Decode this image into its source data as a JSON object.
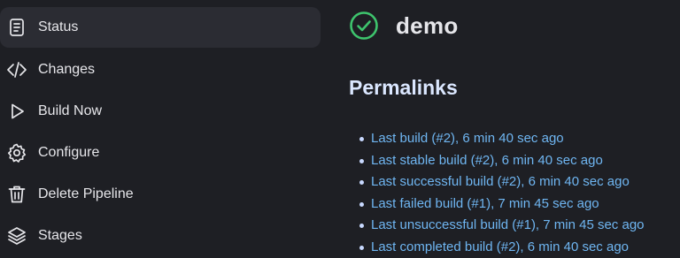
{
  "sidebar": {
    "items": [
      {
        "label": "Status",
        "icon": "document-icon",
        "active": true
      },
      {
        "label": "Changes",
        "icon": "code-icon",
        "active": false
      },
      {
        "label": "Build Now",
        "icon": "play-icon",
        "active": false
      },
      {
        "label": "Configure",
        "icon": "gear-icon",
        "active": false
      },
      {
        "label": "Delete Pipeline",
        "icon": "trash-icon",
        "active": false
      },
      {
        "label": "Stages",
        "icon": "layers-icon",
        "active": false
      }
    ]
  },
  "main": {
    "title": "demo",
    "status_icon": "success-check-icon",
    "section_title": "Permalinks",
    "permalinks": [
      "Last build (#2), 6 min 40 sec ago",
      "Last stable build (#2), 6 min 40 sec ago",
      "Last successful build (#2), 6 min 40 sec ago",
      "Last failed build (#1), 7 min 45 sec ago",
      "Last unsuccessful build (#1), 7 min 45 sec ago",
      "Last completed build (#2), 6 min 40 sec ago"
    ]
  },
  "colors": {
    "background": "#1e1f24",
    "active_item": "#2b2c33",
    "success": "#3ec46d",
    "link": "#6fb6f2",
    "heading": "#dbe7ff"
  }
}
